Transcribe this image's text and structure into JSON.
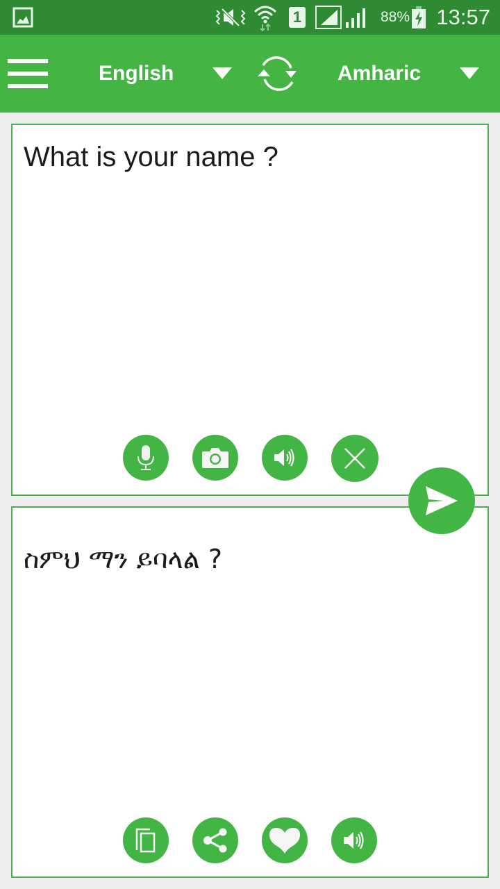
{
  "status_bar": {
    "time": "13:57",
    "battery_percent": "88%",
    "sim_slot": "1",
    "icons": [
      "gallery-notification-icon",
      "vibrate-mute-icon",
      "wifi-icon",
      "sim-1-icon",
      "signal-icon",
      "signal-icon",
      "battery-charging-icon"
    ]
  },
  "toolbar": {
    "source_language": "English",
    "target_language": "Amharic",
    "icons": [
      "menu-icon",
      "dropdown-icon",
      "swap-languages-icon",
      "dropdown-icon"
    ]
  },
  "input_panel": {
    "text": "What is your name ?",
    "actions": [
      {
        "name": "microphone",
        "icon": "mic-icon"
      },
      {
        "name": "camera",
        "icon": "camera-icon"
      },
      {
        "name": "speak",
        "icon": "speaker-icon"
      },
      {
        "name": "clear",
        "icon": "close-icon"
      }
    ]
  },
  "translate_button": {
    "icon": "send-icon"
  },
  "output_panel": {
    "text": "ስምህ ማን ይባላል ?",
    "actions": [
      {
        "name": "copy",
        "icon": "copy-icon"
      },
      {
        "name": "share",
        "icon": "share-icon"
      },
      {
        "name": "favorite",
        "icon": "heart-icon"
      },
      {
        "name": "speak",
        "icon": "speaker-icon"
      }
    ]
  },
  "colors": {
    "status_bar": "#2e8b33",
    "toolbar": "#44b543",
    "accent": "#43b545",
    "panel_border": "#4caf50",
    "background": "#eeeeee"
  }
}
